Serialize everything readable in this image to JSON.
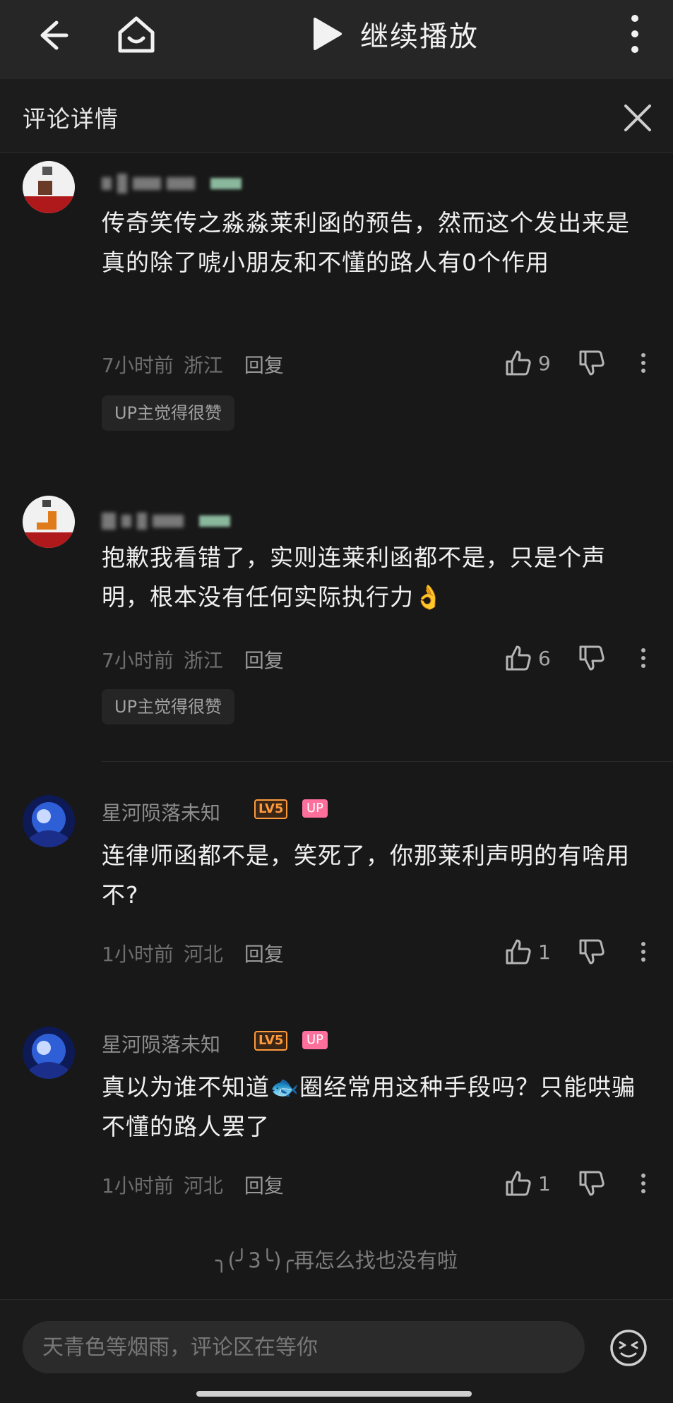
{
  "topbar": {
    "play_label": "继续播放"
  },
  "sheet": {
    "title": "评论详情"
  },
  "comments": [
    {
      "text": "传奇笑传之淼淼莱利函的预告，然而这个发出来是真的除了唬小朋友和不懂的路人有0个作用",
      "time": "7小时前",
      "location": "浙江",
      "reply_label": "回复",
      "likes": "9",
      "up_liked": "UP主觉得很赞"
    },
    {
      "text": "抱歉我看错了，实则连莱利函都不是，只是个声明，根本没有任何实际执行力👌",
      "time": "7小时前",
      "location": "浙江",
      "reply_label": "回复",
      "likes": "6",
      "up_liked": "UP主觉得很赞"
    },
    {
      "username": "星河陨落未知",
      "level": "LV5",
      "up_badge": "UP",
      "text": "连律师函都不是，笑死了，你那莱利声明的有啥用不?",
      "time": "1小时前",
      "location": "河北",
      "reply_label": "回复",
      "likes": "1"
    },
    {
      "username": "星河陨落未知",
      "level": "LV5",
      "up_badge": "UP",
      "text": "真以为谁不知道🐟圈经常用这种手段吗？只能哄骗不懂的路人罢了",
      "time": "1小时前",
      "location": "河北",
      "reply_label": "回复",
      "likes": "1"
    }
  ],
  "end_text": "╮(╯3╰)╭再怎么找也没有啦",
  "input": {
    "placeholder": "天青色等烟雨，评论区在等你"
  },
  "colors": {
    "background": "#181818",
    "up_badge": "#ff6f9c",
    "level_badge": "#ff9a3c"
  }
}
